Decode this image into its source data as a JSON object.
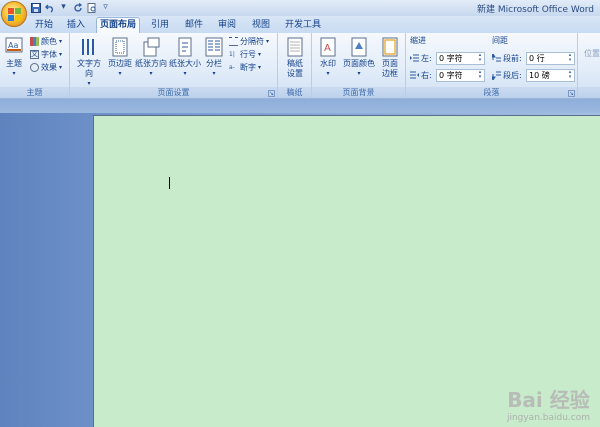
{
  "app": {
    "title": "新建 Microsoft Office Word"
  },
  "quick_access": [
    "save",
    "undo",
    "redo",
    "print-preview"
  ],
  "tabs": [
    {
      "label": "开始",
      "active": false
    },
    {
      "label": "插入",
      "active": false
    },
    {
      "label": "页面布局",
      "active": true
    },
    {
      "label": "引用",
      "active": false
    },
    {
      "label": "邮件",
      "active": false
    },
    {
      "label": "审阅",
      "active": false
    },
    {
      "label": "视图",
      "active": false
    },
    {
      "label": "开发工具",
      "active": false
    }
  ],
  "ribbon": {
    "theme_group": {
      "label": "主题",
      "theme_button": "主题",
      "colors": "颜色",
      "fonts": "字体",
      "effects": "效果"
    },
    "page_setup_group": {
      "label": "页面设置",
      "text_direction": "文字方向",
      "margins": "页边距",
      "orientation": "纸张方向",
      "size": "纸张大小",
      "columns": "分栏",
      "breaks": "分隔符",
      "line_numbers": "行号",
      "hyphenation": "断字"
    },
    "manuscript_group": {
      "label": "稿纸",
      "settings_line1": "稿纸",
      "settings_line2": "设置"
    },
    "page_background_group": {
      "label": "页面背景",
      "watermark": "水印",
      "page_color": "页面颜色",
      "page_borders_line1": "页面",
      "page_borders_line2": "边框"
    },
    "paragraph_group": {
      "label": "段落",
      "indent_header": "缩进",
      "indent_left_label": "左:",
      "indent_left_value": "0 字符",
      "indent_right_label": "右:",
      "indent_right_value": "0 字符",
      "spacing_header": "间距",
      "spacing_before_label": "段前:",
      "spacing_before_value": "0 行",
      "spacing_after_label": "段后:",
      "spacing_after_value": "10 磅"
    },
    "arrange_group": {
      "position": "位置"
    }
  },
  "colors": {
    "page_background": "#c8ebcb",
    "ribbon_text": "#15428b",
    "workspace": "#6f90c4"
  },
  "watermark": {
    "main": "Bai 经验",
    "sub": "jingyan.baidu.com"
  }
}
